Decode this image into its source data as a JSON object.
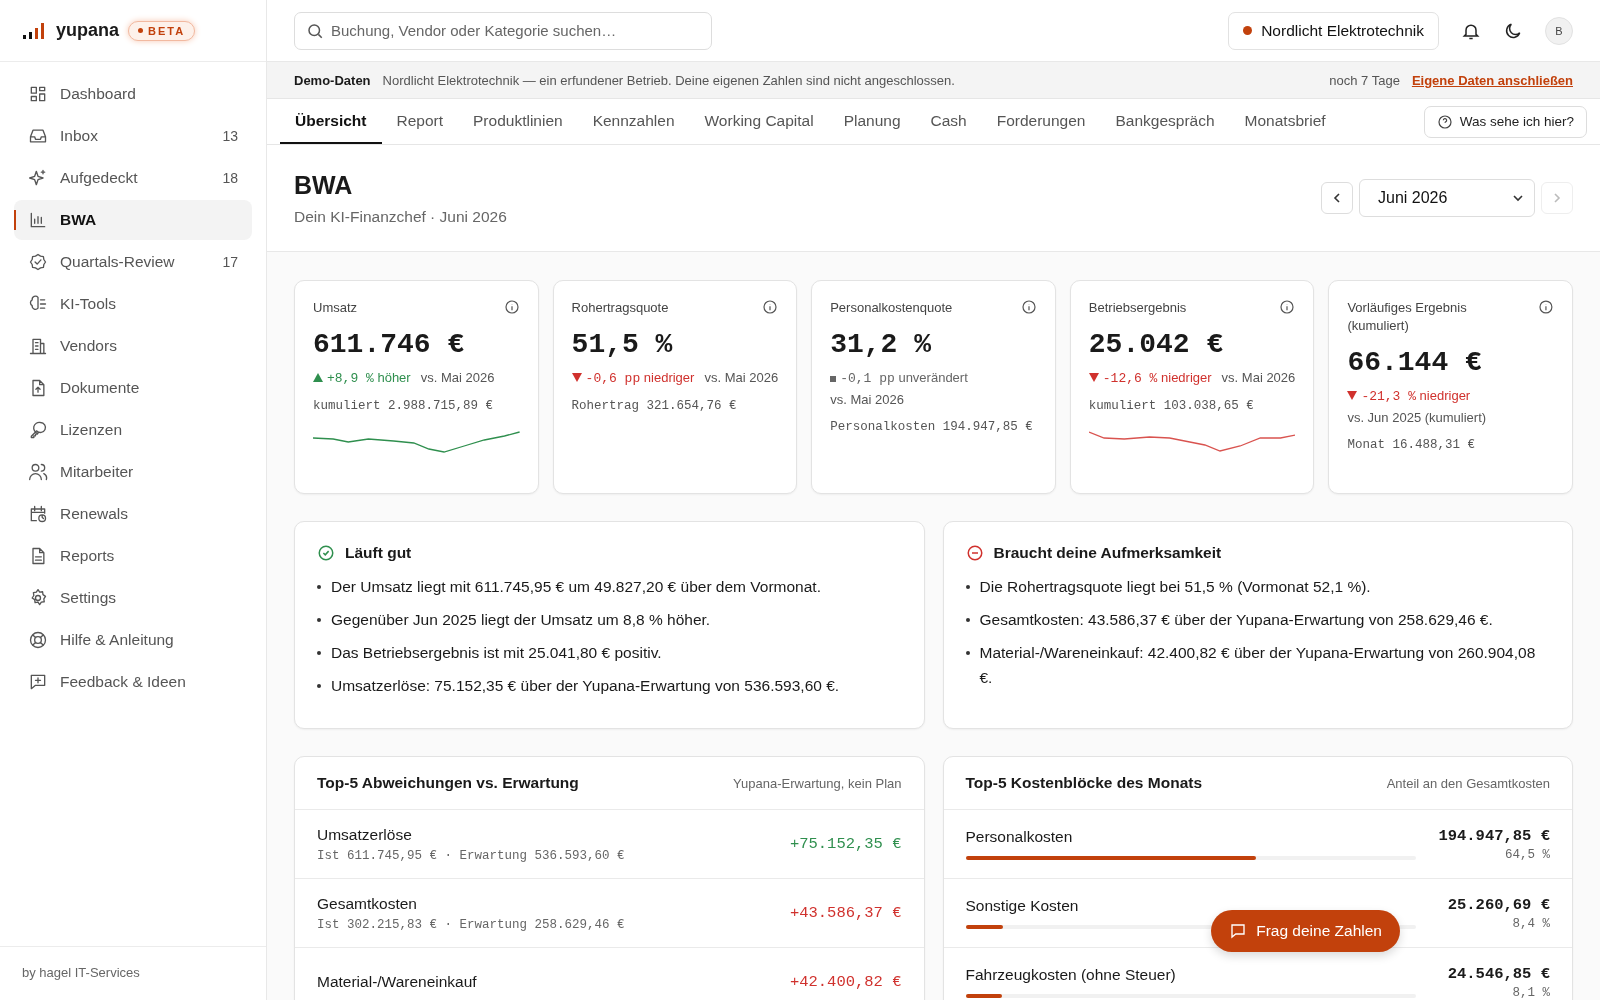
{
  "brand": {
    "name": "yupana",
    "badge": "BETA"
  },
  "sidebar": {
    "items": [
      {
        "label": "Dashboard",
        "selected": false
      },
      {
        "label": "Inbox",
        "count": "13",
        "selected": false
      },
      {
        "label": "Aufgedeckt",
        "count": "18",
        "selected": false
      },
      {
        "label": "BWA",
        "selected": true
      },
      {
        "label": "Quartals-Review",
        "count": "17",
        "selected": false
      },
      {
        "label": "KI-Tools",
        "selected": false
      },
      {
        "label": "Vendors",
        "selected": false
      },
      {
        "label": "Dokumente",
        "selected": false
      },
      {
        "label": "Lizenzen",
        "selected": false
      },
      {
        "label": "Mitarbeiter",
        "selected": false
      },
      {
        "label": "Renewals",
        "selected": false
      },
      {
        "label": "Reports",
        "selected": false
      },
      {
        "label": "Settings",
        "selected": false
      },
      {
        "label": "Hilfe & Anleitung",
        "selected": false
      },
      {
        "label": "Feedback & Ideen",
        "selected": false
      }
    ],
    "footer": "by hagel IT-Services"
  },
  "topbar": {
    "search": {
      "placeholder": "Buchung, Vendor oder Kategorie suchen…"
    },
    "company": "Nordlicht Elektrotechnik",
    "avatar": "B"
  },
  "demo_bar": {
    "label": "Demo-Daten",
    "text": "Nordlicht Elektrotechnik — ein erfundener Betrieb. Deine eigenen Zahlen sind nicht angeschlossen.",
    "days": "noch 7 Tage",
    "link": "Eigene Daten anschließen"
  },
  "tabs": [
    {
      "label": "Übersicht",
      "selected": true
    },
    {
      "label": "Report",
      "selected": false
    },
    {
      "label": "Produktlinien",
      "selected": false
    },
    {
      "label": "Kennzahlen",
      "selected": false
    },
    {
      "label": "Working Capital",
      "selected": false
    },
    {
      "label": "Planung",
      "selected": false
    },
    {
      "label": "Cash",
      "selected": false
    },
    {
      "label": "Forderungen",
      "selected": false
    },
    {
      "label": "Bankgespräch",
      "selected": false
    },
    {
      "label": "Monatsbrief",
      "selected": false
    }
  ],
  "help_button": "Was sehe ich hier?",
  "page": {
    "title": "BWA",
    "subtitle": "Dein KI-Finanzchef · Juni 2026",
    "month": "Juni 2026"
  },
  "kpis": [
    {
      "label": "Umsatz",
      "value": "611.746 €",
      "kind": "up",
      "delta": "+8,9",
      "unit": "%",
      "word": "höher",
      "compare": "vs. Mai 2026",
      "extra": "kumuliert 2.988.715,89 €",
      "trend_line": true
    },
    {
      "label": "Rohertragsquote",
      "value": "51,5 %",
      "kind": "down",
      "delta": "-0,6",
      "unit": "pp",
      "word": "niedriger",
      "compare": "vs. Mai 2026",
      "extra": "Rohertrag 321.654,76 €",
      "trend_line": false
    },
    {
      "label": "Personalkostenquote",
      "value": "31,2 %",
      "kind": "flat",
      "delta": "-0,1",
      "unit": "pp",
      "word": "unverändert",
      "compare": "vs. Mai 2026",
      "extra": "Personalkosten 194.947,85 €",
      "trend_line": false
    },
    {
      "label": "Betriebsergebnis",
      "value": "25.042 €",
      "kind": "down",
      "delta": "-12,6",
      "unit": "%",
      "word": "niedriger",
      "compare": "vs. Mai 2026",
      "extra": "kumuliert 103.038,65 €",
      "trend_line": true
    },
    {
      "label": "Vorläufiges Ergebnis (kumuliert)",
      "value": "66.144 €",
      "kind": "down",
      "delta": "-21,3",
      "unit": "%",
      "word": "niedriger",
      "compare": "vs. Jun 2025 (kumuliert)",
      "extra": "Monat 16.488,31 €",
      "trend_line": false
    }
  ],
  "insights": [
    {
      "kind": "good",
      "title": "Läuft gut",
      "bullets": [
        "Der Umsatz liegt mit 611.745,95 € um 49.827,20 € über dem Vormonat.",
        "Gegenüber Jun 2025 liegt der Umsatz um 8,8 % höher.",
        "Das Betriebsergebnis ist mit 25.041,80 € positiv.",
        "Umsatzerlöse: 75.152,35 € über der Yupana-Erwartung von 536.593,60 €."
      ]
    },
    {
      "kind": "attention",
      "title": "Braucht deine Aufmerksamkeit",
      "bullets": [
        "Die Rohertragsquote liegt bei 51,5 % (Vormonat 52,1 %).",
        "Gesamtkosten: 43.586,37 € über der Yupana-Erwartung von 258.629,46 €.",
        "Material-/Wareneinkauf: 42.400,82 € über der Yupana-Erwartung von 260.904,08 €."
      ]
    }
  ],
  "deviations": {
    "title": "Top-5 Abweichungen vs. Erwartung",
    "note": "Yupana-Erwartung, kein Plan",
    "rows": [
      {
        "label": "Umsatzerlöse",
        "detail": "Ist 611.745,95 € · Erwartung 536.593,60 €",
        "value": "+75.152,35 €",
        "kind": "good"
      },
      {
        "label": "Gesamtkosten",
        "detail": "Ist 302.215,83 € · Erwartung 258.629,46 €",
        "value": "+43.586,37 €",
        "kind": "bad"
      },
      {
        "label": "Material-/Wareneinkauf",
        "value": "+42.400,82 €",
        "kind": "bad"
      }
    ]
  },
  "costs": {
    "title": "Top-5 Kostenblöcke des Monats",
    "note": "Anteil an den Gesamtkosten",
    "rows": [
      {
        "label": "Personalkosten",
        "value": "194.947,85 €",
        "share": "64,5 %",
        "level": 0.645
      },
      {
        "label": "Sonstige Kosten",
        "value": "25.260,69 €",
        "share": "8,4 %",
        "level": 0.084
      },
      {
        "label": "Fahrzeugkosten (ohne Steuer)",
        "value": "24.546,85 €",
        "share": "8,1 %",
        "level": 0.081
      }
    ]
  },
  "chat_button": "Frag deine Zahlen"
}
